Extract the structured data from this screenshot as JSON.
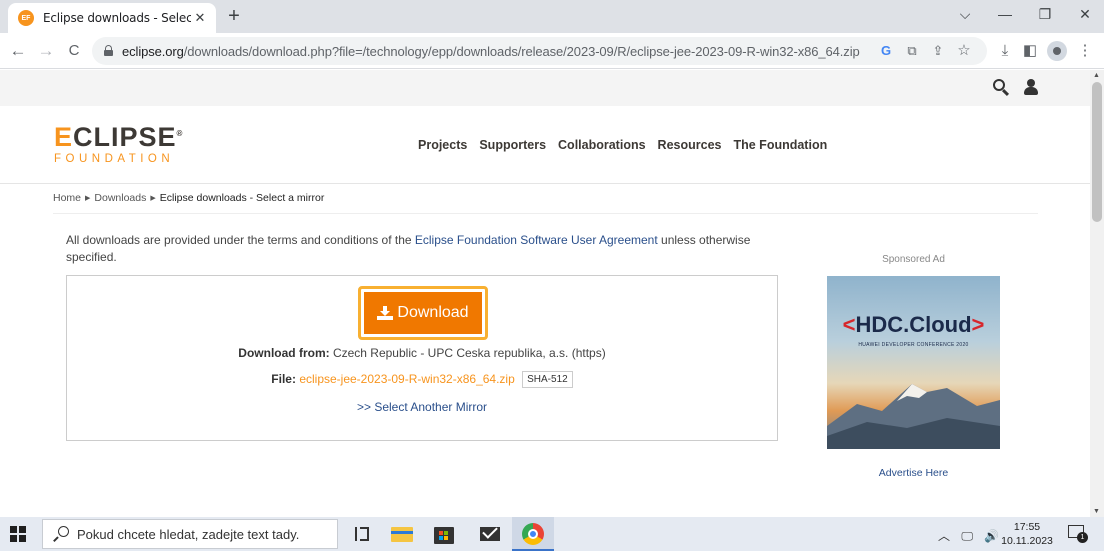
{
  "browser": {
    "tab": {
      "favicon_text": "EF",
      "title": "Eclipse downloads - Select a mir",
      "close_glyph": "✕",
      "favicon_color": "#f7941e"
    },
    "newtab_glyph": "+",
    "window_controls": {
      "dropdown": "⌵",
      "minimize": "—",
      "restore": "❐",
      "close": "✕"
    },
    "nav": {
      "back": "←",
      "forward": "→",
      "reload": "C"
    },
    "url_host": "eclipse.org",
    "url_path": "/downloads/download.php?file=/technology/epp/downloads/release/2023-09/R/eclipse-jee-2023-09-R-win32-x86_64.zip",
    "omnibox_icons": {
      "google": "G",
      "translate": "⧉",
      "share": "⇪",
      "bookmark": "☆"
    },
    "toolbar_icons": {
      "downloads": "⤓",
      "sidepanel": "◧",
      "menu": "⋮"
    }
  },
  "site": {
    "logo": {
      "first_letter": "E",
      "rest": "CLIPSE",
      "registered": "®",
      "subtitle": "FOUNDATION"
    },
    "nav": [
      "Projects",
      "Supporters",
      "Collaborations",
      "Resources",
      "The Foundation"
    ],
    "accent_color": "#f7941e"
  },
  "breadcrumb": {
    "home": "Home",
    "downloads": "Downloads",
    "current": "Eclipse downloads - Select a mirror",
    "sep": "▶"
  },
  "terms": {
    "before": "All downloads are provided under the terms and conditions of the ",
    "link": "Eclipse Foundation Software User Agreement",
    "after": " unless otherwise specified."
  },
  "download": {
    "button_label": "Download",
    "from_label": "Download from:",
    "from_value": " Czech Republic - UPC Ceska republika, a.s. (https)",
    "file_label": "File:",
    "file_name": "eclipse-jee-2023-09-R-win32-x86_64.zip",
    "sha_label": "SHA-512",
    "mirror_link": ">> Select Another Mirror",
    "button_color": "#f07800"
  },
  "ad": {
    "label": "Sponsored Ad",
    "title_left": "<",
    "title_main": "HDC.Cloud",
    "title_right": ">",
    "subtitle": "HUAWEI DEVELOPER CONFERENCE 2020",
    "advertise_link": "Advertise Here"
  },
  "taskbar": {
    "search_placeholder": "Pokud chcete hledat, zadejte text tady.",
    "tray": "︿ 🖵 🔊",
    "time": "17:55",
    "date": "10.11.2023",
    "notification_count": "1"
  }
}
